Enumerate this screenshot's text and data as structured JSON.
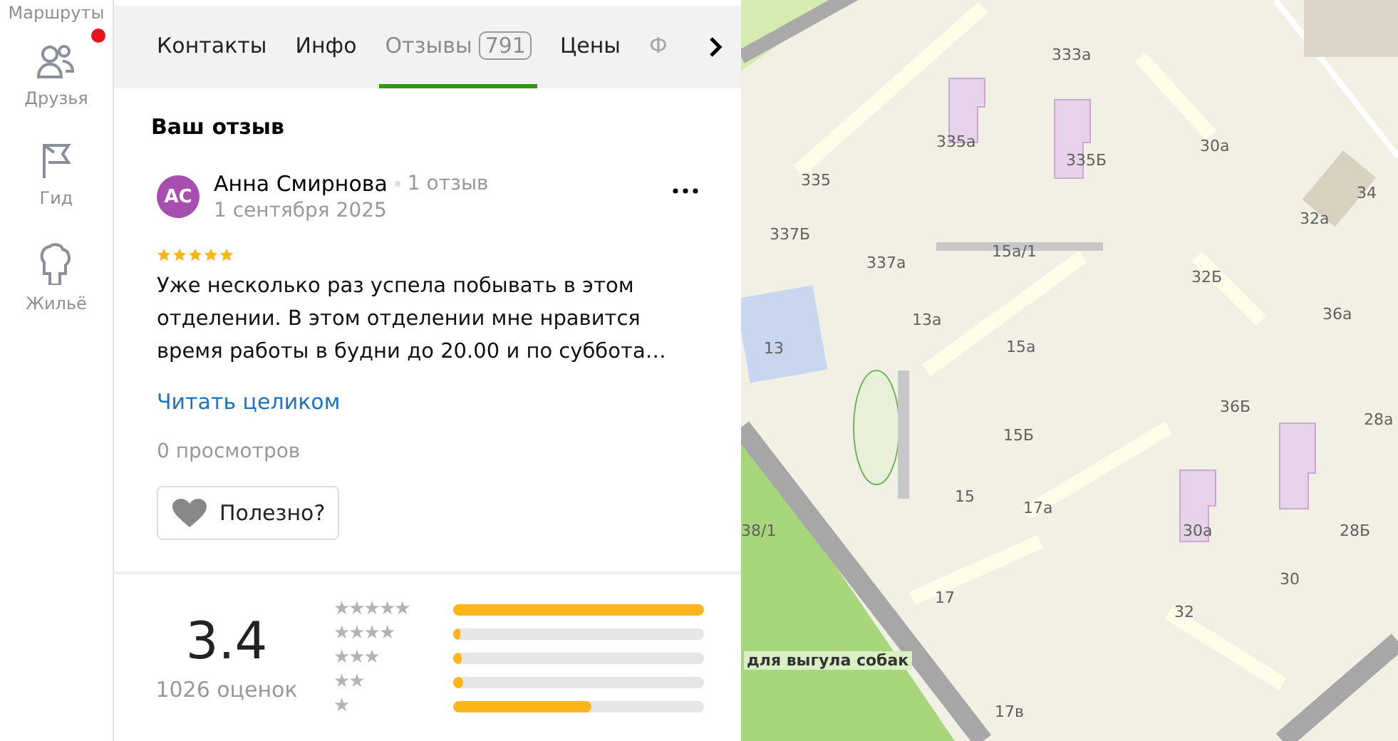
{
  "sidebar": {
    "items": [
      {
        "label": "Маршруты",
        "kind": "route",
        "badge": false
      },
      {
        "label": "Друзья",
        "kind": "friends",
        "badge": true
      },
      {
        "label": "Гид",
        "kind": "guide",
        "badge": false
      },
      {
        "label": "Жильё",
        "kind": "housing",
        "badge": false
      }
    ]
  },
  "tabs": [
    {
      "label": "Контакты",
      "selected": false
    },
    {
      "label": "Инфо",
      "selected": false
    },
    {
      "label": "Отзывы",
      "count": "791",
      "selected": true
    },
    {
      "label": "Цены",
      "selected": false
    },
    {
      "label": "Ф",
      "selected": false,
      "faded": true
    }
  ],
  "my_review": {
    "heading": "Ваш отзыв",
    "author_initials": "АС",
    "author": "Анна Смирнова",
    "author_reviews": "1 отзыв",
    "date": "1 сентября 2025",
    "stars": 5,
    "text": "Уже несколько раз успела побывать в этом отделении. В этом отделении мне нравится время работы в будни до 20.00 и по суббота…",
    "read_more": "Читать целиком",
    "views": "0 просмотров",
    "helpful": "Полезно?"
  },
  "rating": {
    "score": "3.4",
    "count": "1026 оценок",
    "rows": [
      {
        "label": "★★★★★",
        "level": 1
      },
      {
        "label": "★★★★",
        "level": 0.03
      },
      {
        "label": "★★★",
        "level": 0.035
      },
      {
        "label": "★★",
        "level": 0.04
      },
      {
        "label": "★",
        "level": 0.55
      }
    ]
  },
  "map": {
    "labels": [
      "333а",
      "335а",
      "335Б",
      "30а",
      "34",
      "335",
      "32а",
      "337Б",
      "15а/1",
      "337а",
      "32Б",
      "13а",
      "36а",
      "13",
      "15а",
      "36Б",
      "28а",
      "15Б",
      "15",
      "17а",
      "38/1",
      "30а",
      "28Б",
      "30",
      "17",
      "32",
      "для выгула собак",
      "17в"
    ]
  }
}
